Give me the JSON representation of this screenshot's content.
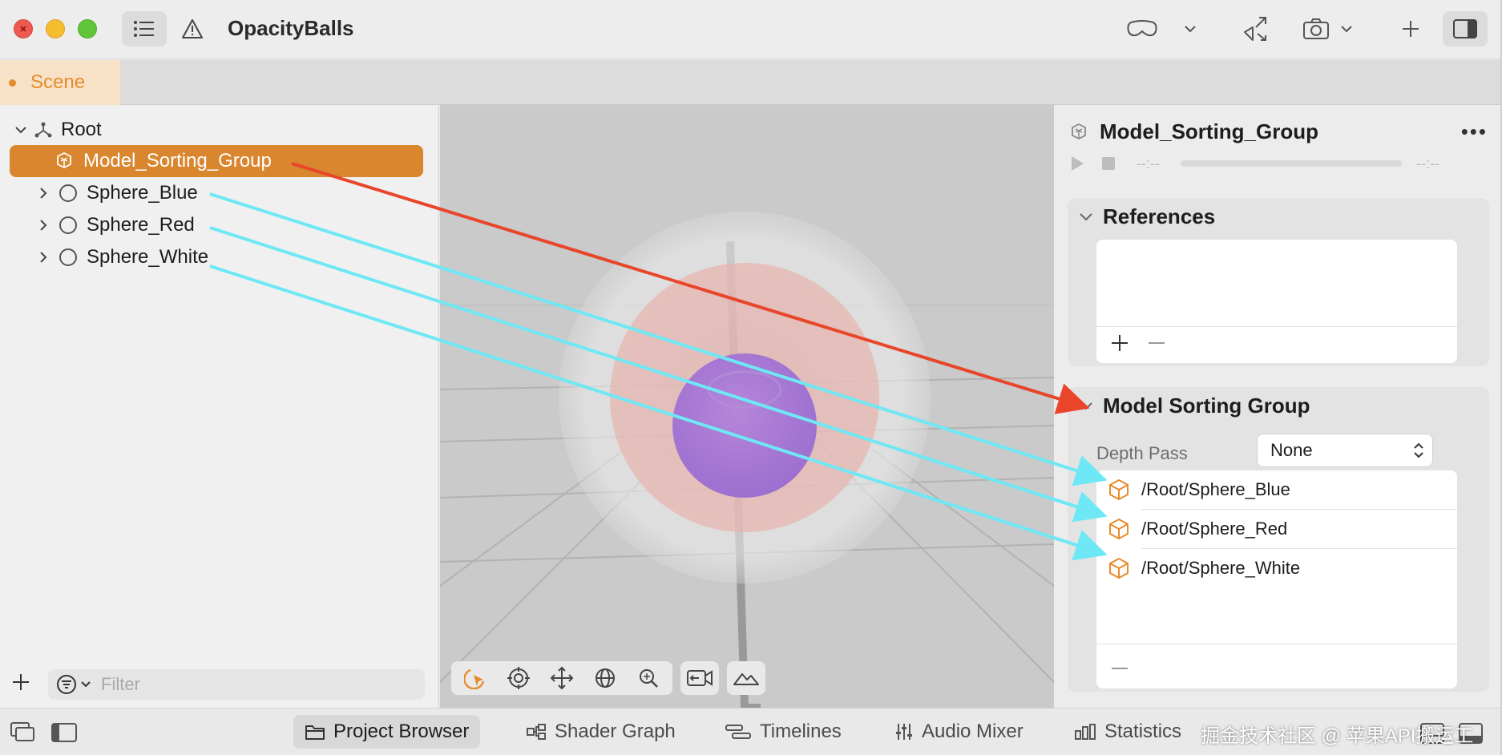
{
  "window": {
    "title": "OpacityBalls",
    "scene_tab": "Scene"
  },
  "hierarchy": {
    "root_label": "Root",
    "items": [
      {
        "label": "Model_Sorting_Group",
        "selected": true
      },
      {
        "label": "Sphere_Blue",
        "selected": false
      },
      {
        "label": "Sphere_Red",
        "selected": false
      },
      {
        "label": "Sphere_White",
        "selected": false
      }
    ],
    "filter_placeholder": "Filter"
  },
  "inspector": {
    "title": "Model_Sorting_Group",
    "time_start": "--:--",
    "time_end": "--:--",
    "references_header": "References",
    "model_sorting_header": "Model Sorting Group",
    "depth_pass_label": "Depth Pass",
    "depth_pass_value": "None",
    "entities": [
      "/Root/Sphere_Blue",
      "/Root/Sphere_Red",
      "/Root/Sphere_White"
    ]
  },
  "bottom_tabs": [
    {
      "label": "Project Browser",
      "active": true
    },
    {
      "label": "Shader Graph",
      "active": false
    },
    {
      "label": "Timelines",
      "active": false
    },
    {
      "label": "Audio Mixer",
      "active": false
    },
    {
      "label": "Statistics",
      "active": false
    }
  ],
  "watermark": "掘金技术社区 @ 苹果API搬运工",
  "colors": {
    "accent_orange": "#d9862e",
    "annotation_red": "#e8452a",
    "annotation_cyan": "#6ee8f5"
  }
}
